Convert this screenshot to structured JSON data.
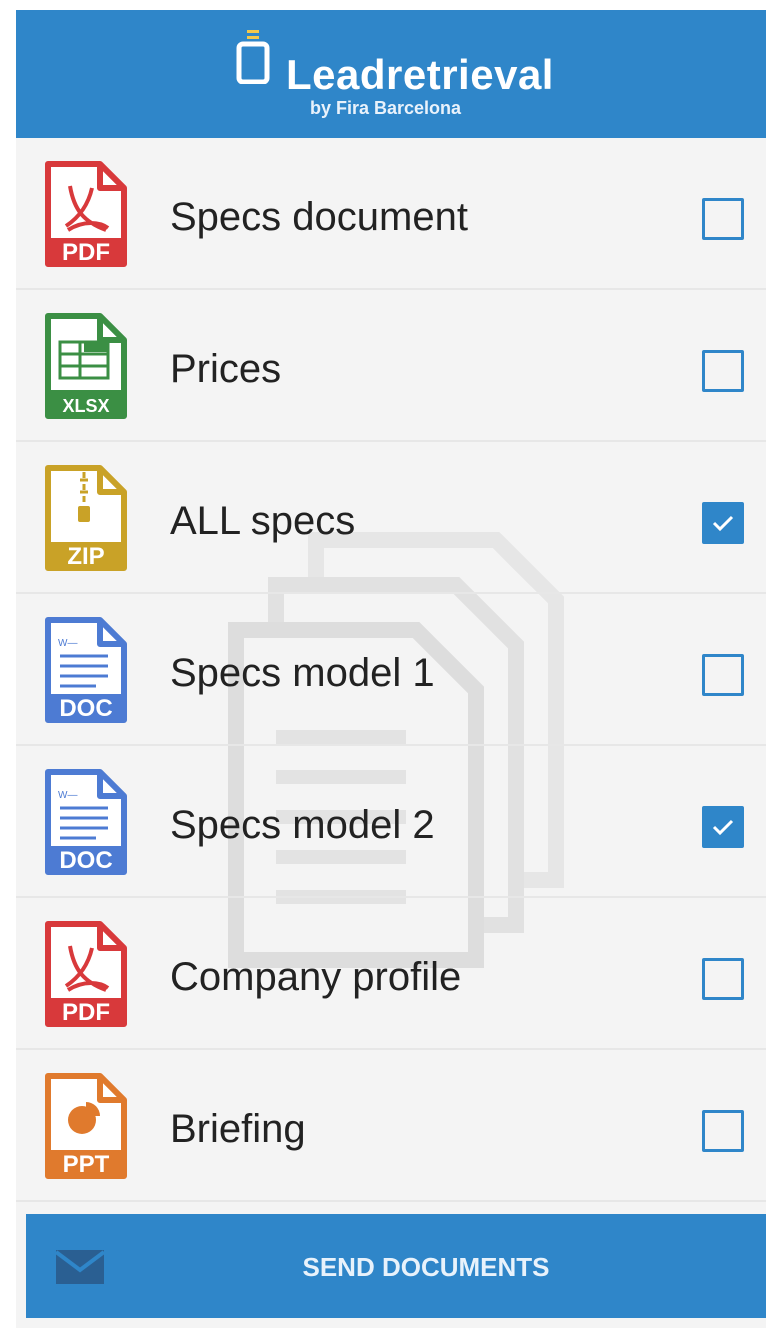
{
  "header": {
    "title": "Leadretrieval",
    "subtitle": "by Fira Barcelona",
    "logo_icon": "phone-icon"
  },
  "documents": [
    {
      "label": "Specs document",
      "type": "PDF",
      "icon": "pdf-file-icon",
      "checked": false,
      "color": "#d8393b"
    },
    {
      "label": "Prices",
      "type": "XLSX",
      "icon": "xlsx-file-icon",
      "checked": false,
      "color": "#3b8f44"
    },
    {
      "label": "ALL specs",
      "type": "ZIP",
      "icon": "zip-file-icon",
      "checked": true,
      "color": "#c9a227"
    },
    {
      "label": "Specs model 1",
      "type": "DOC",
      "icon": "doc-file-icon",
      "checked": false,
      "color": "#4d7bd3"
    },
    {
      "label": "Specs model 2",
      "type": "DOC",
      "icon": "doc-file-icon",
      "checked": true,
      "color": "#4d7bd3"
    },
    {
      "label": "Company profile",
      "type": "PDF",
      "icon": "pdf-file-icon",
      "checked": false,
      "color": "#d8393b"
    },
    {
      "label": "Briefing",
      "type": "PPT",
      "icon": "ppt-file-icon",
      "checked": false,
      "color": "#e07a2d"
    }
  ],
  "send_button": {
    "label": "SEND DOCUMENTS",
    "icon": "envelope-icon"
  },
  "colors": {
    "accent": "#2f86c9",
    "background": "#f4f4f4"
  }
}
